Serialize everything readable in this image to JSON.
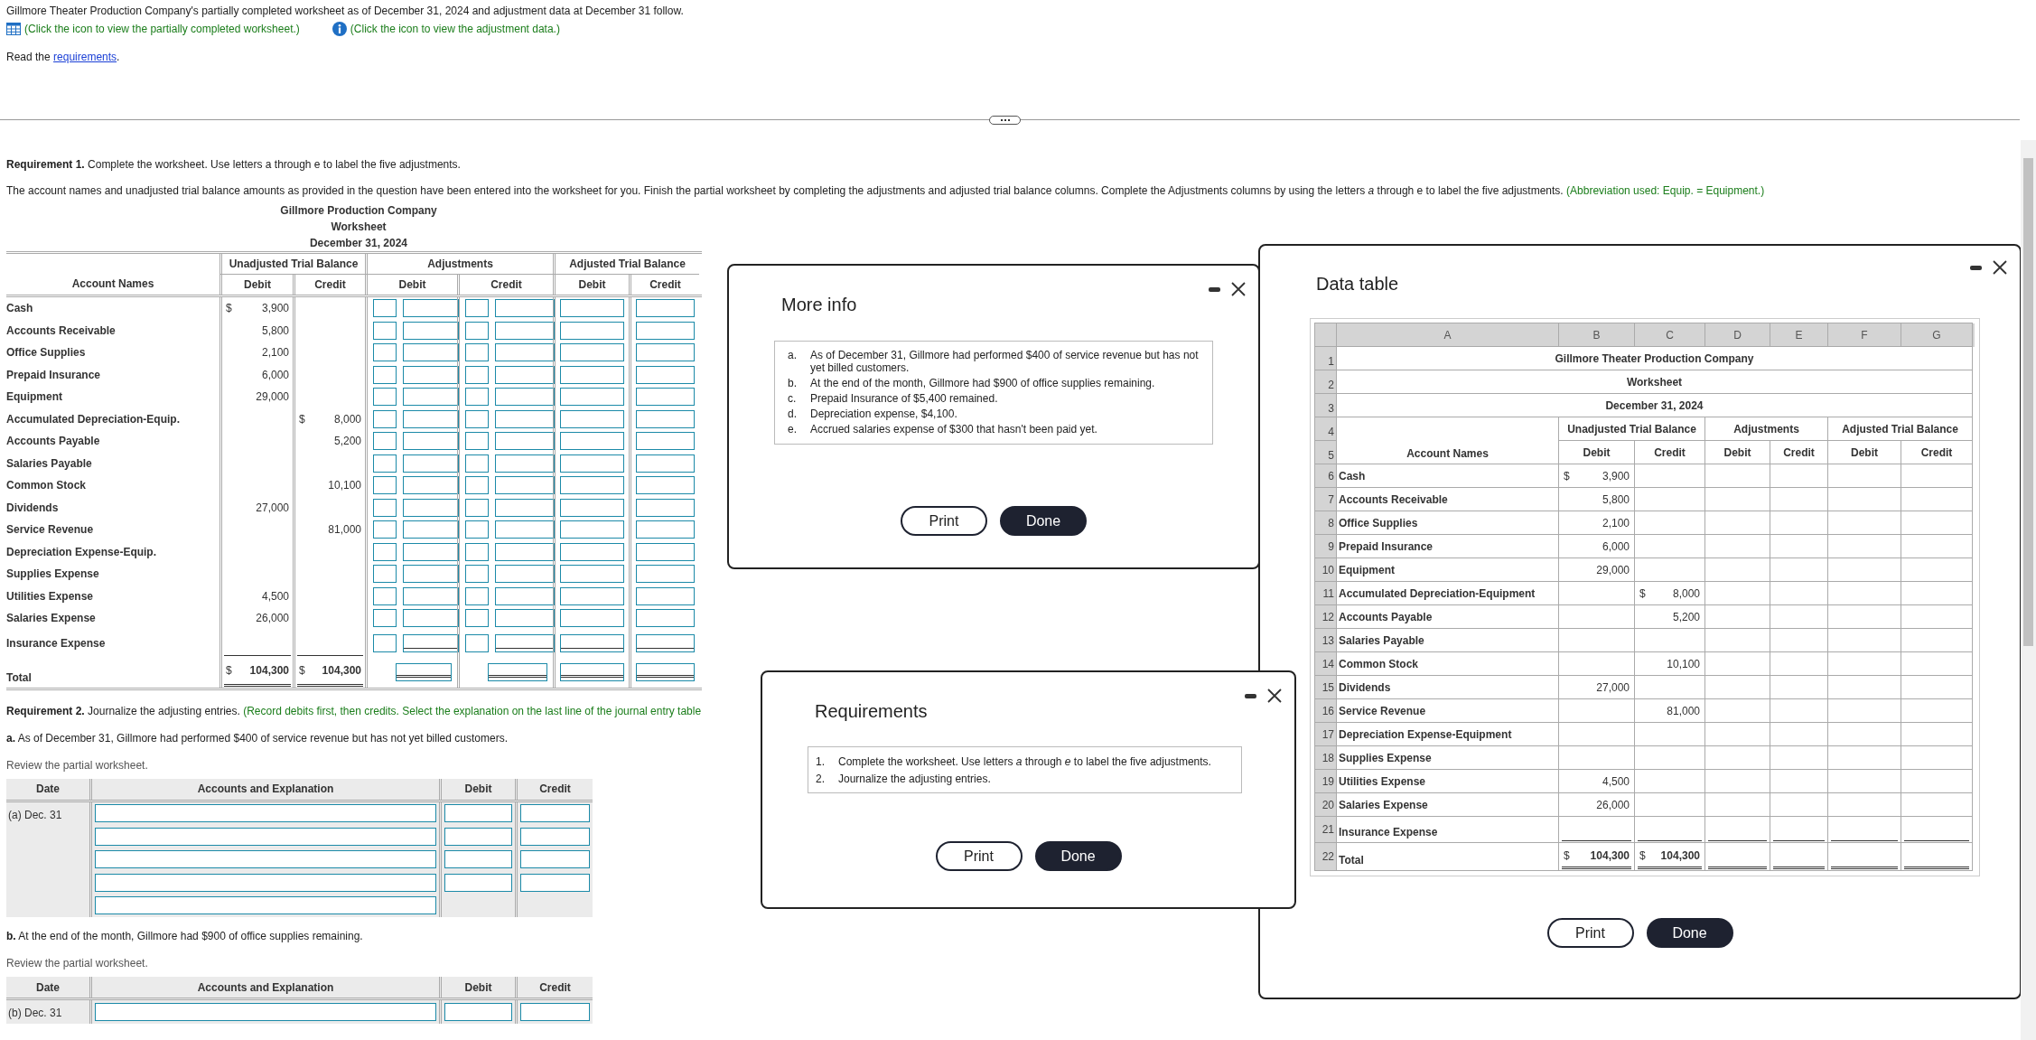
{
  "intro": {
    "text": "Gillmore Theater Production Company's partially completed worksheet as of December 31, 2024 and adjustment data at December 31 follow.",
    "worksheet_link": "(Click the icon to view the partially completed worksheet.)",
    "data_link": "(Click the icon to view the adjustment data.)",
    "read": {
      "before": "Read the ",
      "link": "requirements",
      "after": "."
    }
  },
  "requirement_1": {
    "heading": "**Requirement 1.** Complete the worksheet. Use letters a through e to label the five adjustments.",
    "instructions": "The account names and unadjusted trial balance amounts as provided in the question have been entered into the worksheet for you. Finish the partial worksheet by completing the adjustments and adjusted trial balance columns. Complete the Adjustments columns by using the letters *a* through e to label the five adjustments.",
    "note": "(Abbreviation used: Equip. = Equipment.)"
  },
  "worksheet": {
    "title_lines": [
      "Gillmore Production Company",
      "Worksheet",
      "December 31, 2024"
    ],
    "account_header": "Account Names",
    "groups": [
      "Unadjusted Trial Balance",
      "Adjustments",
      "Adjusted Trial Balance"
    ],
    "subheaders": [
      "Debit",
      "Credit",
      "Debit",
      "Credit",
      "Debit",
      "Credit"
    ],
    "rows": [
      {
        "kind": "account",
        "name": "Cash",
        "debit": "3,900",
        "debit_currency": "$"
      },
      {
        "kind": "account",
        "name": "Accounts Receivable",
        "debit": "5,800"
      },
      {
        "kind": "account",
        "name": "Office Supplies",
        "debit": "2,100"
      },
      {
        "kind": "account",
        "name": "Prepaid Insurance",
        "debit": "6,000"
      },
      {
        "kind": "account",
        "name": "Equipment",
        "debit": "29,000"
      },
      {
        "kind": "account",
        "name": "Accumulated Depreciation-Equip.",
        "credit": "8,000",
        "credit_currency": "$"
      },
      {
        "kind": "account",
        "name": "Accounts Payable",
        "credit": "5,200"
      },
      {
        "kind": "account",
        "name": "Salaries Payable"
      },
      {
        "kind": "account",
        "name": "Common Stock",
        "credit": "10,100"
      },
      {
        "kind": "account",
        "name": "Dividends",
        "debit": "27,000"
      },
      {
        "kind": "account",
        "name": "Service Revenue",
        "credit": "81,000"
      },
      {
        "kind": "account",
        "name": "Depreciation Expense-Equip."
      },
      {
        "kind": "account",
        "name": "Supplies Expense"
      },
      {
        "kind": "account",
        "name": "Utilities Expense",
        "debit": "4,500"
      },
      {
        "kind": "account",
        "name": "Salaries Expense",
        "debit": "26,000"
      },
      {
        "kind": "last",
        "name": "Insurance Expense"
      },
      {
        "kind": "total",
        "name": "Total",
        "debit": "104,300",
        "debit_currency": "$",
        "credit": "104,300",
        "credit_currency": "$"
      }
    ]
  },
  "requirement_2": {
    "heading": "**Requirement 2.** Journalize the adjusting entries.",
    "note": "(Record debits first, then credits. Select the explanation on the last line of the journal entry table",
    "entries": [
      {
        "heading": "**a.** As of December 31, Gillmore had performed $400 of service revenue but has not yet billed customers.",
        "review": "Review the partial worksheet.",
        "columns": [
          "Date",
          "Accounts and Explanation",
          "Debit",
          "Credit"
        ],
        "date": "(a) Dec. 31",
        "rows": [
          {
            "kind": "entry"
          },
          {
            "kind": "entry"
          },
          {
            "kind": "entry"
          },
          {
            "kind": "entry"
          },
          {
            "kind": "explanation"
          }
        ]
      },
      {
        "heading": "**b.** At the end of the month, Gillmore had $900 of office supplies remaining.",
        "review": "Review the partial worksheet.",
        "columns": [
          "Date",
          "Accounts and Explanation",
          "Debit",
          "Credit"
        ],
        "date": "(b) Dec. 31",
        "rows": [
          {
            "kind": "entry"
          }
        ]
      }
    ]
  },
  "more_info": {
    "title": "More info",
    "items": [
      {
        "marker": "a.",
        "text": "As of December 31, Gillmore had performed $400 of service revenue but has not yet billed customers."
      },
      {
        "marker": "b.",
        "text": "At the end of the month, Gillmore had $900 of office supplies remaining."
      },
      {
        "marker": "c.",
        "text": "Prepaid Insurance of $5,400 remained."
      },
      {
        "marker": "d.",
        "text": "Depreciation expense, $4,100."
      },
      {
        "marker": "e.",
        "text": "Accrued salaries expense of $300 that hasn't been paid yet."
      }
    ],
    "buttons": [
      {
        "label": "Print",
        "kind": "secondary"
      },
      {
        "label": "Done",
        "kind": "primary"
      }
    ]
  },
  "requirements": {
    "title": "Requirements",
    "items": [
      {
        "marker": "1.",
        "text": "Complete the worksheet. Use letters *a* through *e* to label the five adjustments."
      },
      {
        "marker": "2.",
        "text": "Journalize the adjusting entries."
      }
    ],
    "buttons": [
      {
        "label": "Print",
        "kind": "secondary"
      },
      {
        "label": "Done",
        "kind": "primary"
      }
    ]
  },
  "data_table": {
    "title": "Data table",
    "column_letters": [
      "A",
      "B",
      "C",
      "D",
      "E",
      "F",
      "G"
    ],
    "title_rows": [
      {
        "number": "1",
        "text": "Gillmore Theater Production Company"
      },
      {
        "number": "2",
        "text": "Worksheet"
      },
      {
        "number": "3",
        "text": "December 31, 2024"
      }
    ],
    "header_numbers": [
      "4",
      "5"
    ],
    "account_header": "Account Names",
    "groups": [
      "Unadjusted Trial Balance",
      "Adjustments",
      "Adjusted Trial Balance"
    ],
    "subheaders": [
      "Debit",
      "Credit",
      "Debit",
      "Credit",
      "Debit",
      "Credit"
    ],
    "rows": [
      {
        "number": "6",
        "kind": "account",
        "name": "Cash",
        "debit": "3,900",
        "debit_currency": "$"
      },
      {
        "number": "7",
        "kind": "account",
        "name": "Accounts Receivable",
        "debit": "5,800"
      },
      {
        "number": "8",
        "kind": "account",
        "name": "Office Supplies",
        "debit": "2,100"
      },
      {
        "number": "9",
        "kind": "account",
        "name": "Prepaid Insurance",
        "debit": "6,000"
      },
      {
        "number": "10",
        "kind": "account",
        "name": "Equipment",
        "debit": "29,000"
      },
      {
        "number": "11",
        "kind": "account",
        "name": "Accumulated Depreciation-Equipment",
        "credit": "8,000",
        "credit_currency": "$"
      },
      {
        "number": "12",
        "kind": "account",
        "name": "Accounts Payable",
        "credit": "5,200"
      },
      {
        "number": "13",
        "kind": "account",
        "name": "Salaries Payable"
      },
      {
        "number": "14",
        "kind": "account",
        "name": "Common Stock",
        "credit": "10,100"
      },
      {
        "number": "15",
        "kind": "account",
        "name": "Dividends",
        "debit": "27,000"
      },
      {
        "number": "16",
        "kind": "account",
        "name": "Service Revenue",
        "credit": "81,000"
      },
      {
        "number": "17",
        "kind": "account",
        "name": "Depreciation Expense-Equipment"
      },
      {
        "number": "18",
        "kind": "account",
        "name": "Supplies Expense"
      },
      {
        "number": "19",
        "kind": "account",
        "name": "Utilities Expense",
        "debit": "4,500"
      },
      {
        "number": "20",
        "kind": "account",
        "name": "Salaries Expense",
        "debit": "26,000"
      },
      {
        "number": "21",
        "kind": "last",
        "name": "Insurance Expense"
      },
      {
        "number": "22",
        "kind": "total",
        "name": "Total",
        "debit": "104,300",
        "debit_currency": "$",
        "credit": "104,300",
        "credit_currency": "$"
      }
    ],
    "buttons": [
      {
        "label": "Print",
        "kind": "secondary"
      },
      {
        "label": "Done",
        "kind": "primary"
      }
    ]
  }
}
